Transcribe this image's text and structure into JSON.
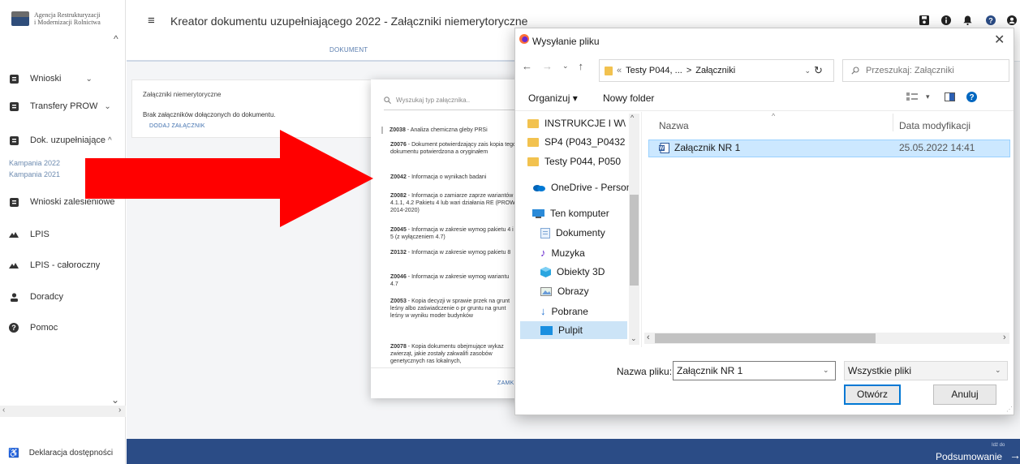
{
  "app": {
    "logo_text_line1": "Agencja Restrukturyzacji",
    "logo_text_line2": "i Modernizacji Rolnictwa",
    "title": "Kreator dokumentu uzupełniającego 2022 - Załączniki niemerytoryczne",
    "tab_document": "DOKUMENT"
  },
  "sidebar": {
    "items": [
      {
        "label": "Wnioski",
        "icon": "document-icon"
      },
      {
        "label": "Transfery PROW",
        "icon": "document-icon"
      },
      {
        "label": "Dok. uzupełniające",
        "icon": "document-icon"
      },
      {
        "label": "Wnioski zalesieniowe",
        "icon": "document-icon"
      },
      {
        "label": "LPIS",
        "icon": "mountain-icon"
      },
      {
        "label": "LPIS - całoroczny",
        "icon": "mountain-icon"
      },
      {
        "label": "Doradcy",
        "icon": "person-icon"
      },
      {
        "label": "Pomoc",
        "icon": "help-icon"
      }
    ],
    "subitems": [
      "Kampania 2022",
      "Kampania 2021"
    ],
    "footer": "Deklaracja dostępności"
  },
  "card": {
    "heading": "Załączniki niemerytoryczne",
    "empty_text": "Brak załączników dołączonych do dokumentu.",
    "add_button": "DODAJ ZAŁĄCZNIK"
  },
  "picker": {
    "search_placeholder": "Wyszukaj typ załącznika..",
    "items": [
      {
        "code": "Z0038",
        "text": " - Analiza chemiczna gleby PRSi"
      },
      {
        "code": "Z0076",
        "text": " - Dokument potwierdzający zais kopia tego dokumentu potwierdzona a oryginałem"
      },
      {
        "code": "Z0042",
        "text": " - Informacja o wynikach badani"
      },
      {
        "code": "Z0082",
        "text": " - Informacja o zamiarze zaprze wariantów 4.1.1, 4.2 Pakietu 4 lub wari działania RE (PROW 2014-2020)"
      },
      {
        "code": "Z0045",
        "text": " - Informacja w zakresie wymog pakietu 4 i 5 (z wyłączeniem 4.7)"
      },
      {
        "code": "Z0132",
        "text": " - Informacja w zakresie wymog pakietu 8"
      },
      {
        "code": "Z0046",
        "text": " - Informacja w zakresie wymog wariantu 4.7"
      },
      {
        "code": "Z0053",
        "text": " - Kopia decyzji w sprawie przek na grunt leśny albo zaświadczenie o pr gruntu na grunt leśny w wyniku moder budynków"
      },
      {
        "code": "Z0078",
        "text": " - Kopia dokumentu obejmujące wykaz zwierząt, jakie zostały zakwalifi zasobów genetycznych ras lokalnych,"
      }
    ],
    "close_button": "ZAMK"
  },
  "dialog": {
    "title": "Wysyłanie pliku",
    "address_parts": [
      "«",
      "Testy P044, ...",
      ">",
      "Załączniki"
    ],
    "search_placeholder": "Przeszukaj: Załączniki",
    "organize": "Organizuj ▾",
    "new_folder": "Nowy folder",
    "tree": [
      {
        "label": "INSTRUKCJE I W\\",
        "icon": "folder-icon"
      },
      {
        "label": "SP4 (P043_P0432",
        "icon": "folder-icon"
      },
      {
        "label": "Testy P044, P050",
        "icon": "folder-icon"
      },
      {
        "label": "OneDrive - Person",
        "icon": "cloud-icon"
      },
      {
        "label": "Ten komputer",
        "icon": "computer-icon"
      },
      {
        "label": "Dokumenty",
        "icon": "documents-icon"
      },
      {
        "label": "Muzyka",
        "icon": "music-icon"
      },
      {
        "label": "Obiekty 3D",
        "icon": "cube-icon"
      },
      {
        "label": "Obrazy",
        "icon": "pictures-icon"
      },
      {
        "label": "Pobrane",
        "icon": "download-icon"
      },
      {
        "label": "Pulpit",
        "icon": "desktop-icon"
      }
    ],
    "columns": {
      "name": "Nazwa",
      "date": "Data modyfikacji"
    },
    "files": [
      {
        "name": "Załącznik NR 1",
        "date": "25.05.2022 14:41"
      }
    ],
    "filename_label": "Nazwa pliku:",
    "filename_value": "Załącznik NR 1",
    "filter": "Wszystkie pliki",
    "open_button": "Otwórz",
    "cancel_button": "Anuluj"
  },
  "bottom": {
    "next_small": "Idź do",
    "next": "Podsumowanie"
  },
  "colors": {
    "accent_blue": "#2b4c86",
    "annotation_arrow": "#ff0000",
    "selection": "#cce8ff"
  }
}
